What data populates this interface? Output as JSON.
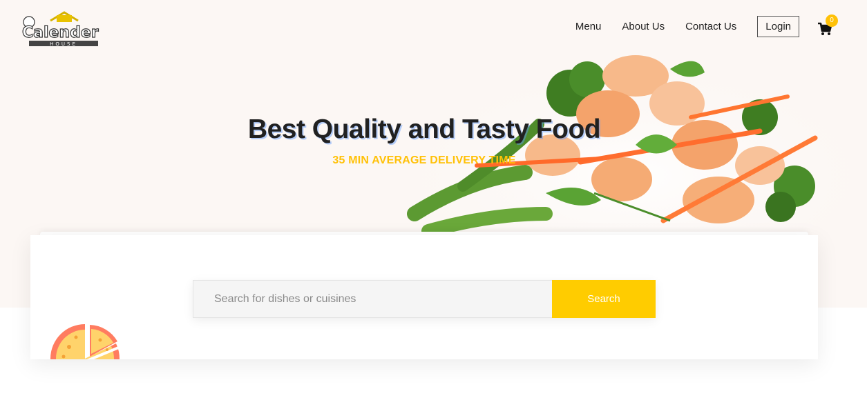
{
  "brand": {
    "logo_name": "Calendar House logo",
    "logo_text": "Calender",
    "logo_sub": "HOUSE"
  },
  "nav": {
    "items": [
      {
        "label": "Menu"
      },
      {
        "label": "About Us"
      },
      {
        "label": "Contact Us"
      }
    ],
    "login_label": "Login",
    "cart_icon": "shopping-cart-icon",
    "cart_count": "0"
  },
  "hero": {
    "title": "Best Quality and Tasty Food",
    "subtitle": "35 MIN AVERAGE DELIVERY TIME",
    "image": "shrimp-vegetable-stir-fry"
  },
  "search": {
    "placeholder": "Search for dishes or cuisines",
    "value": "",
    "button_label": "Search"
  },
  "decor": {
    "pizza_icon": "pizza-icon"
  },
  "colors": {
    "accent": "#ffc107",
    "button": "#ffcc00",
    "hero_bg": "#fcf7f4",
    "text": "#212121"
  }
}
